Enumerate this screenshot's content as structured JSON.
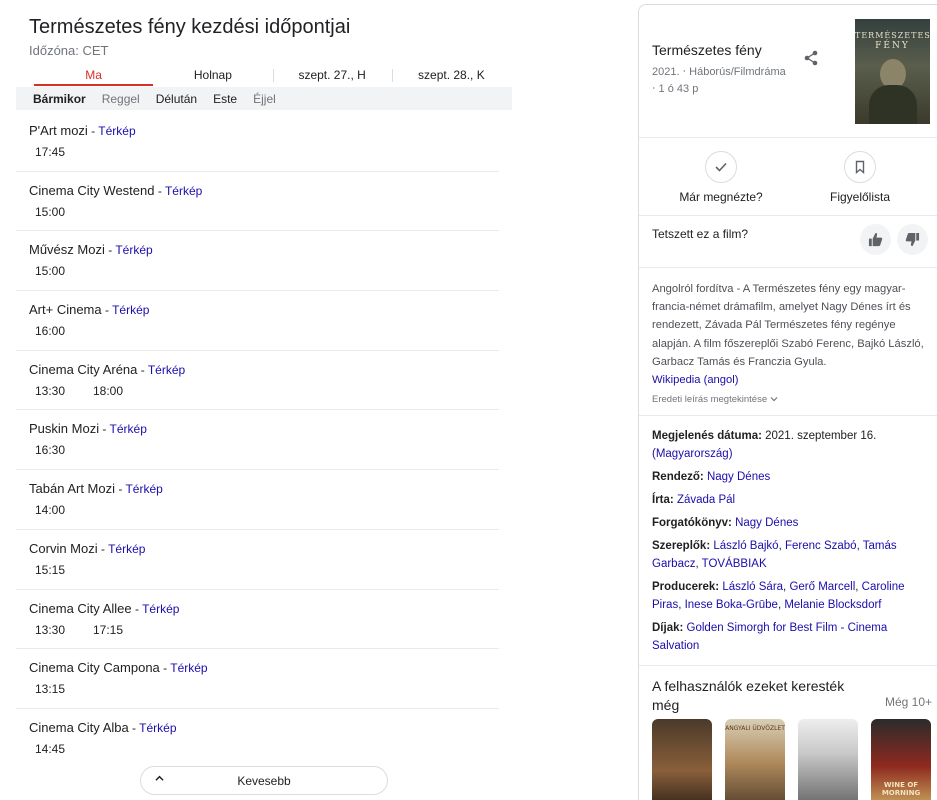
{
  "showtimes": {
    "title": "Természetes fény kezdési időpontjai",
    "timezone": "Időzóna: CET",
    "days": [
      "Ma",
      "Holnap",
      "szept. 27., H",
      "szept. 28., K"
    ],
    "time_filters": [
      "Bármikor",
      "Reggel",
      "Délután",
      "Este",
      "Éjjel"
    ],
    "map_label": "Térkép",
    "cinemas": [
      {
        "name": "P'Art mozi",
        "times": [
          "17:45"
        ]
      },
      {
        "name": "Cinema City Westend",
        "times": [
          "15:00"
        ]
      },
      {
        "name": "Művész Mozi",
        "times": [
          "15:00"
        ]
      },
      {
        "name": "Art+ Cinema",
        "times": [
          "16:00"
        ]
      },
      {
        "name": "Cinema City Aréna",
        "times": [
          "13:30",
          "18:00"
        ]
      },
      {
        "name": "Puskin Mozi",
        "times": [
          "16:30"
        ]
      },
      {
        "name": "Tabán Art Mozi",
        "times": [
          "14:00"
        ]
      },
      {
        "name": "Corvin Mozi",
        "times": [
          "15:15"
        ]
      },
      {
        "name": "Cinema City Allee",
        "times": [
          "13:30",
          "17:15"
        ]
      },
      {
        "name": "Cinema City Campona",
        "times": [
          "13:15"
        ]
      },
      {
        "name": "Cinema City Alba",
        "times": [
          "14:45"
        ]
      }
    ],
    "less_label": "Kevesebb"
  },
  "movie": {
    "title": "Természetes fény",
    "meta_line1": "2021. ‧ Háborús/Filmdráma",
    "meta_line2": "‧ 1 ó 43 p",
    "poster": {
      "line1": "TERMÉSZETES",
      "line2": "FÉNY"
    },
    "actions": {
      "watched": "Már megnézte?",
      "watchlist": "Figyelőlista"
    },
    "liked_question": "Tetszett ez a film?",
    "description": "Angolról fordítva - A Természetes fény egy magyar-francia-német drámafilm, amelyet Nagy Dénes írt és rendezett, Závada Pál Természetes fény regénye alapján. A film főszereplői Szabó Ferenc, Bajkó László, Garbacz Tamás és Franczia Gyula.",
    "wiki_link": "Wikipedia (angol)",
    "original_desc": "Eredeti leírás megtekintése",
    "facts": {
      "release": {
        "label": "Megjelenés dátuma:",
        "value": "2021. szeptember 16.",
        "link": "(Magyarország)"
      },
      "director": {
        "label": "Rendező:",
        "value": "Nagy Dénes"
      },
      "writer": {
        "label": "Írta:",
        "value": "Závada Pál"
      },
      "screenplay": {
        "label": "Forgatókönyv:",
        "value": "Nagy Dénes"
      },
      "cast": {
        "label": "Szereplők:",
        "people": [
          "László Bajkó",
          "Ferenc Szabó",
          "Tamás Garbacz",
          "TOVÁBBIAK"
        ]
      },
      "producers": {
        "label": "Producerek:",
        "people": [
          "László Sára",
          "Gerő Marcell",
          "Caroline Piras",
          "Inese Boka-Grūbe",
          "Melanie Blocksdorf"
        ]
      },
      "awards": {
        "label": "Díjak:",
        "value": "Golden Simorgh for Best Film - Cinema Salvation"
      }
    },
    "also_searched_title": "A felhasználók ezeket keresték még",
    "more_label": "Még 10+",
    "mini_posters": [
      {
        "text": ""
      },
      {
        "text": "ANGYALI ÜDVÖZLET"
      },
      {
        "text": ""
      },
      {
        "text": "WINE OF MORNING"
      }
    ]
  }
}
